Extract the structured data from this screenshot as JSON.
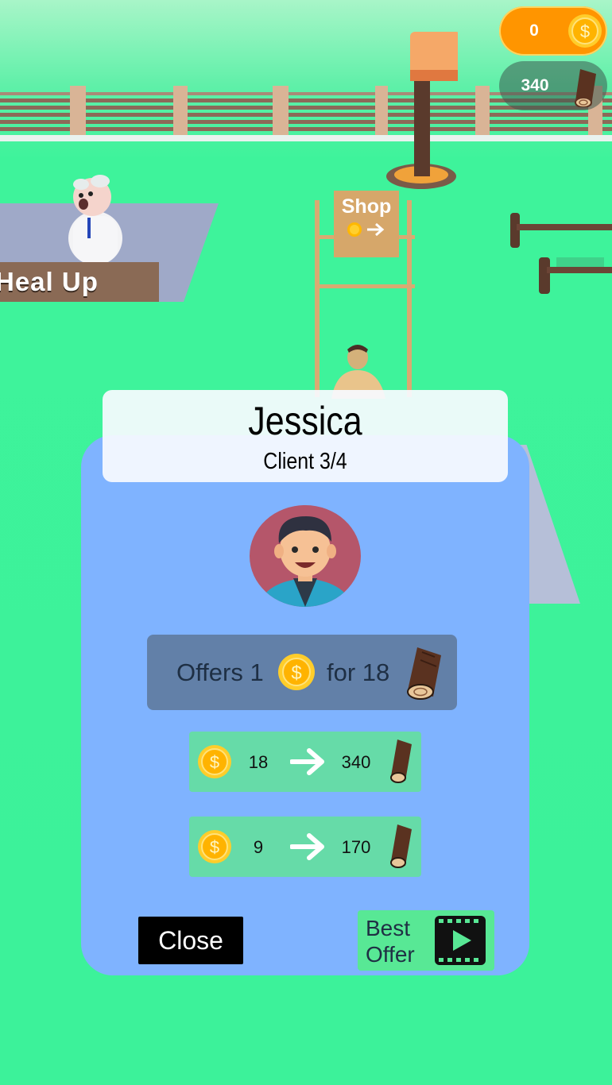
{
  "hud": {
    "coins": "0",
    "wood": "340",
    "coin_icon": "coin-icon",
    "wood_icon": "wood-log-icon"
  },
  "scene": {
    "heal_sign": "Heal Up",
    "shop_sign": "Shop"
  },
  "dialog": {
    "client_name": "Jessica",
    "client_progress": "Client 3/4",
    "offer": {
      "prefix": "Offers 1",
      "suffix": "for 18"
    },
    "trades": [
      {
        "coins": "18",
        "wood": "340"
      },
      {
        "coins": "9",
        "wood": "170"
      }
    ],
    "close_label": "Close",
    "best_offer_label_line1": "Best",
    "best_offer_label_line2": "Offer"
  },
  "colors": {
    "panel": "#7fb3ff",
    "offer_box": "#6280a8",
    "trade_row": "#66dba8",
    "best_button": "#58e895",
    "coin": "#ffb800",
    "ground": "#3cf29a"
  }
}
